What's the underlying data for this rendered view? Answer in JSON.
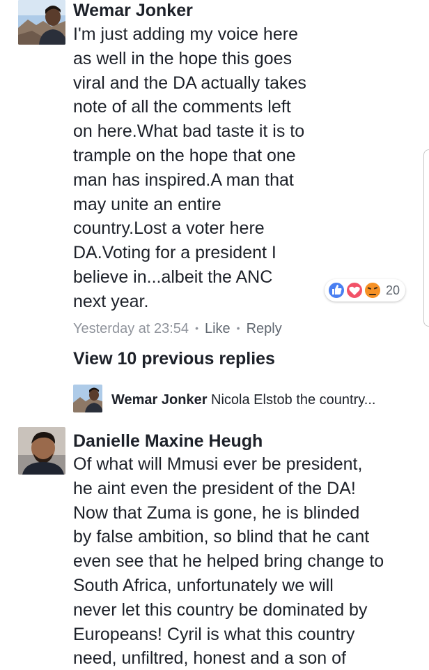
{
  "comments": [
    {
      "author": "Wemar Jonker",
      "avatar_icon": "profile-photo-man-mountains",
      "lines": [
        "I'm just adding my voice here",
        "as well in the hope this goes",
        "viral and the DA actually takes",
        "note of all the  comments left",
        "on here.What bad taste it is to",
        "trample on the hope that one",
        "man has inspired.A man that",
        "may unite an entire",
        "country.Lost a voter here",
        "DA.Voting for a president I",
        "believe in...albeit the ANC",
        "next year."
      ],
      "timestamp": "Yesterday at 23:54",
      "like_label": "Like",
      "reply_label": "Reply",
      "separator": "•",
      "reactions": {
        "icons": [
          "like-icon",
          "love-icon",
          "angry-icon"
        ],
        "count": "20",
        "colors": {
          "like": "#4a7ff1",
          "love": "#f25268",
          "angry": "#f7b125"
        }
      }
    },
    {
      "author": "Danielle Maxine Heugh",
      "avatar_icon": "profile-photo-man-selfie",
      "lines": [
        "Of what will Mmusi ever be president,",
        "he aint even the president of the DA!",
        "Now that Zuma is gone, he is blinded",
        "by false ambition, so blind that he cant",
        "even see that he helped bring change to",
        "South Africa, unfortunately we will",
        "never let this country be dominated by",
        "Europeans! Cyril is what this country",
        "need, unfiltred, honest and a son of"
      ]
    }
  ],
  "view_previous_label": "View 10 previous replies",
  "reply_preview": {
    "author": "Wemar Jonker",
    "snippet": "Nicola Elstob the country..."
  }
}
